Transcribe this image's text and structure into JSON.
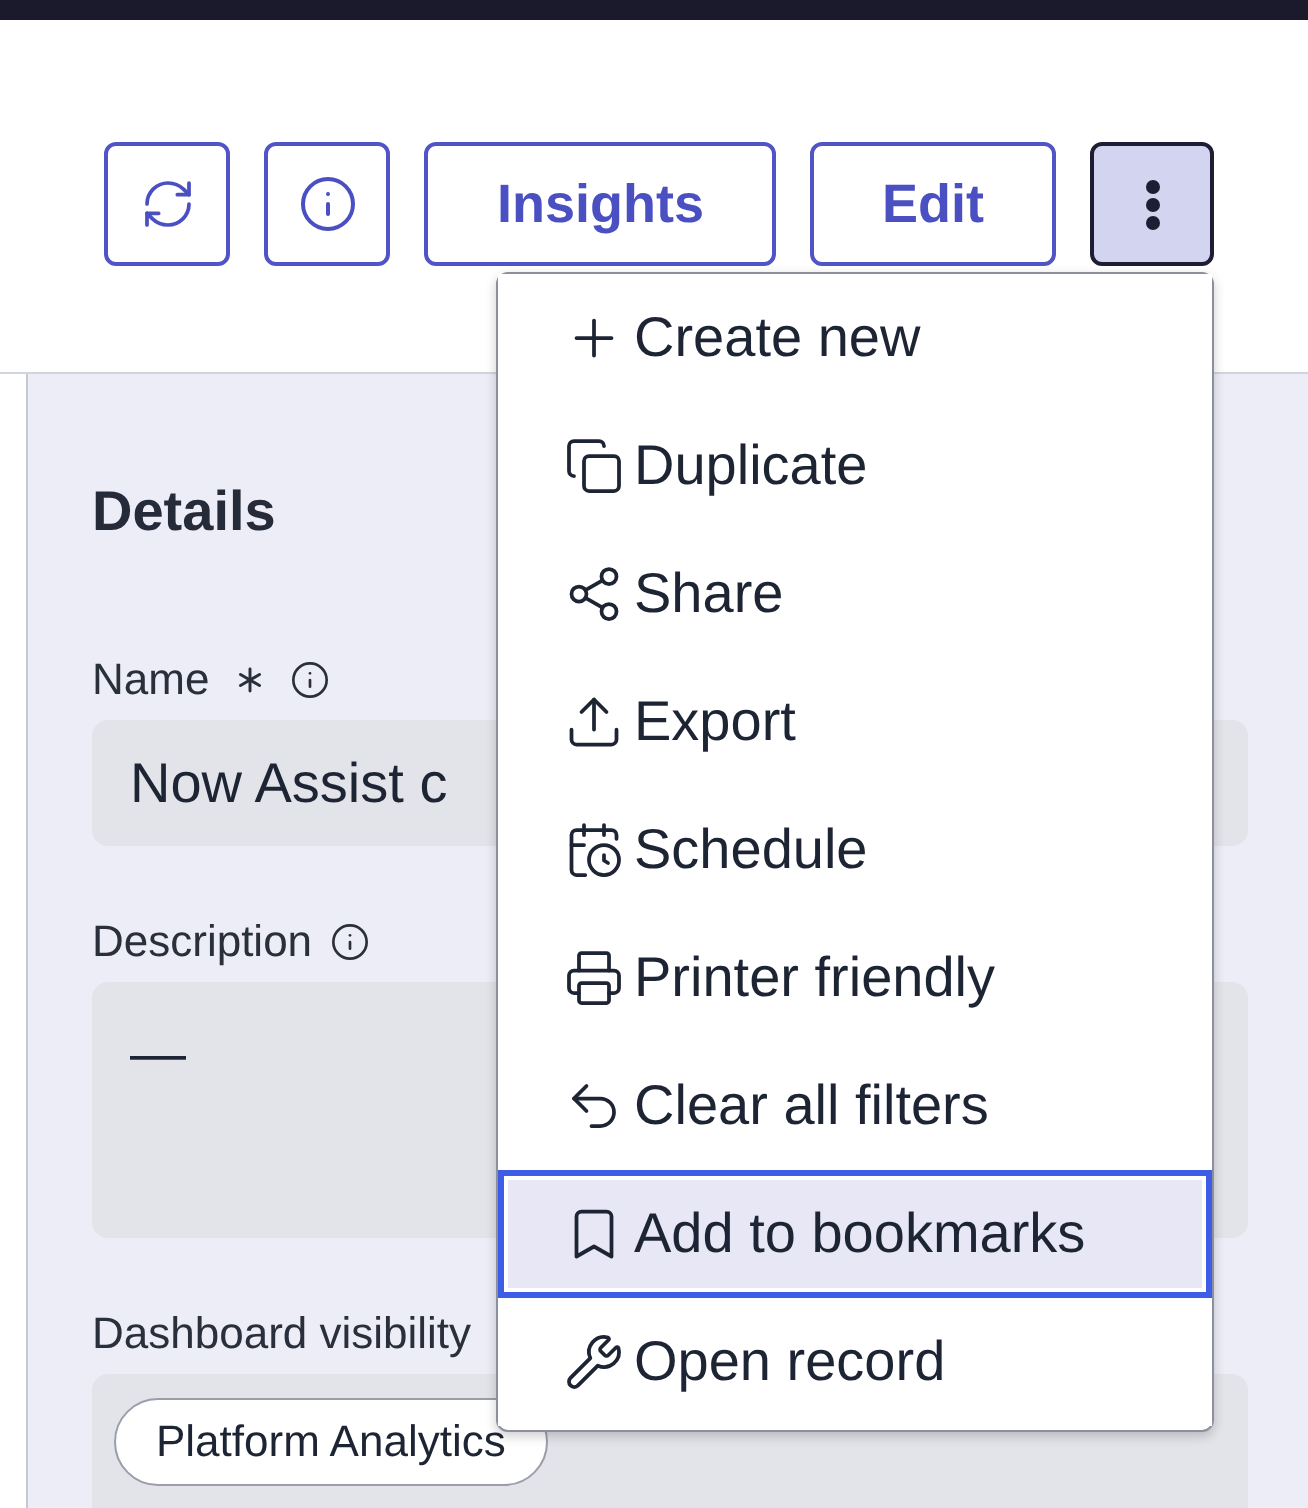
{
  "toolbar": {
    "buttons": [
      {
        "label": "Insights"
      },
      {
        "label": "Edit"
      }
    ],
    "more_button": {
      "expanded": true
    }
  },
  "menu": {
    "items": [
      {
        "label": "Create new",
        "selected": false
      },
      {
        "label": "Duplicate",
        "selected": false
      },
      {
        "label": "Share",
        "selected": false
      },
      {
        "label": "Export",
        "selected": false
      },
      {
        "label": "Schedule",
        "selected": false
      },
      {
        "label": "Printer friendly",
        "selected": false
      },
      {
        "label": "Clear all filters",
        "selected": false
      },
      {
        "label": "Add to bookmarks",
        "selected": true
      },
      {
        "label": "Open record",
        "selected": false
      }
    ]
  },
  "details": {
    "title": "Details",
    "fields": [
      {
        "kind": "text",
        "label": "Name",
        "required": true,
        "info": true,
        "value": "Now Assist c"
      },
      {
        "kind": "textarea",
        "label": "Description",
        "required": false,
        "info": true,
        "value": "—"
      },
      {
        "kind": "chips",
        "label": "Dashboard visibility",
        "required": false,
        "info": false,
        "chips": [
          "Platform Analytics"
        ]
      }
    ]
  }
}
